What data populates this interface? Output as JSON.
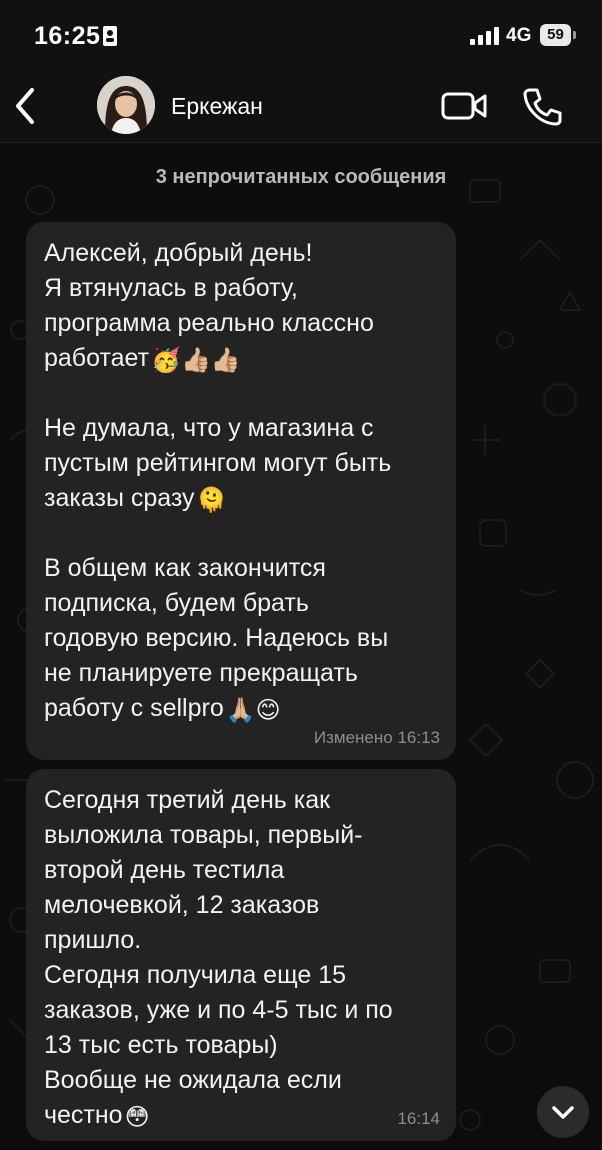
{
  "status_bar": {
    "time": "16:25",
    "network": "4G",
    "battery": "59"
  },
  "header": {
    "contact_name": "Еркежан",
    "icons": [
      "back-icon",
      "avatar",
      "video-camera-icon",
      "phone-icon"
    ]
  },
  "divider": {
    "unread_text": "3 непрочитанных сообщения"
  },
  "messages": [
    {
      "lines": [
        "Алексей, добрый день!",
        "Я втянулась в работу,",
        "программа реально классно",
        "работает",
        "",
        "Не думала, что у магазина с",
        "пустым рейтингом могут быть",
        "заказы сразу",
        "",
        "В общем как закончится",
        "подписка, будем брать",
        "годовую версию. Надеюсь вы",
        "не планируете прекращать",
        "работу с sellpro"
      ],
      "emojis": {
        "line_3": "🥳👍🏼👍🏼",
        "line_7": "🫠",
        "line_13": "🙏🏼😊"
      },
      "edited_label": "Изменено",
      "time": "16:13"
    },
    {
      "lines": [
        "Сегодня третий день как",
        "выложила товары, первый-",
        "второй день тестила",
        "мелочевкой, 12 заказов",
        "пришло.",
        "Сегодня получила еще 15",
        "заказов, уже и по 4-5 тыс и по",
        "13 тыс есть товары)",
        "Вообще не ожидала если",
        "честно"
      ],
      "emojis": {
        "line_9": "😳"
      },
      "time": "16:14"
    }
  ],
  "colors": {
    "background": "#0d0d0d",
    "bubble": "#232323",
    "text": "#f2f2f2",
    "meta": "#8d8d8d"
  }
}
